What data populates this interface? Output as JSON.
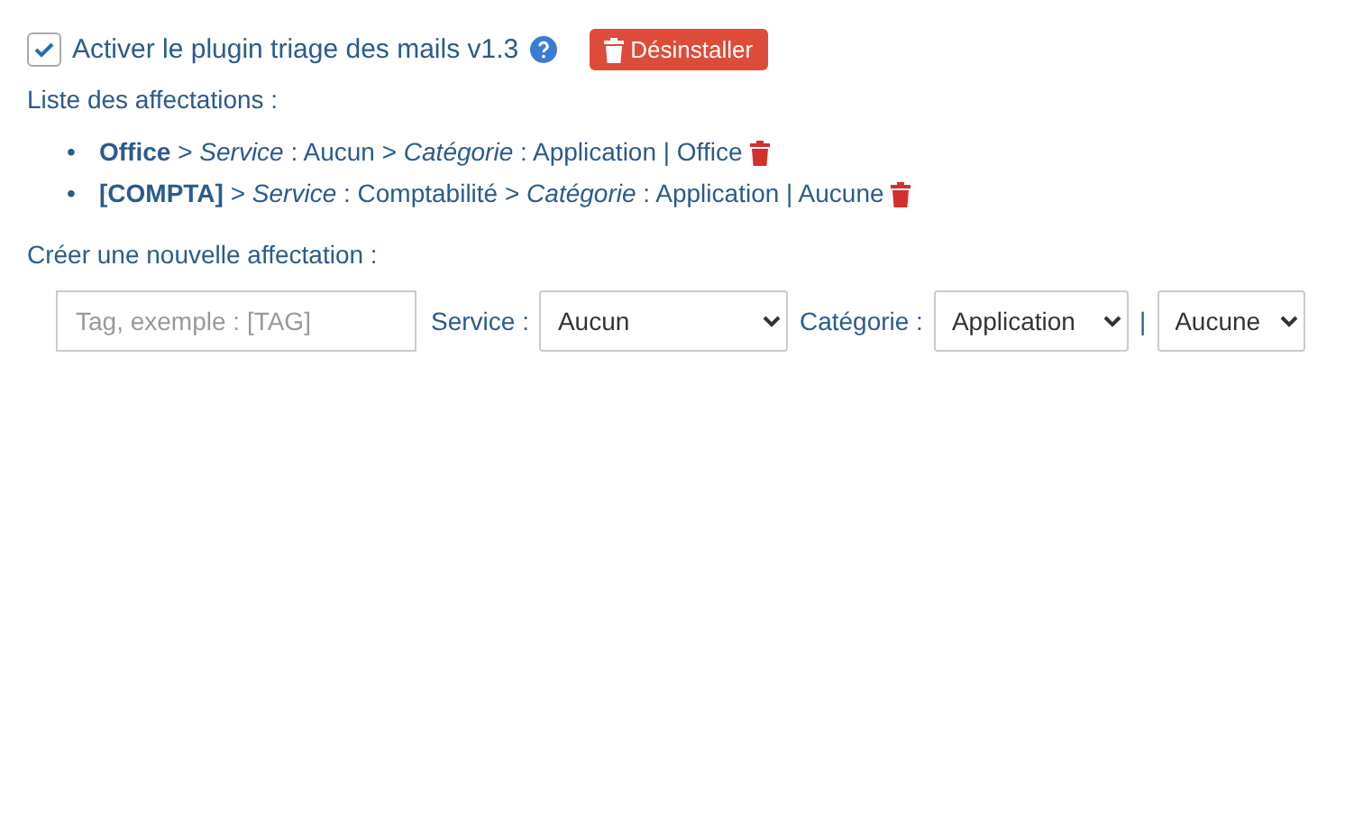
{
  "plugin": {
    "label": "Activer le plugin triage des mails v1.3",
    "checked": true,
    "uninstall": "Désinstaller"
  },
  "list_title": "Liste des affectations :",
  "assignments": [
    {
      "bullet": "•",
      "text": "**Office** > *Service* : Aucun > *Catégorie* : Application | Office"
    },
    {
      "bullet": "•",
      "text": "**[COMPTA]** > *Service* : Comptabilité > *Catégorie* : Application | Aucune"
    }
  ],
  "create_title": "Créer une nouvelle affectation :",
  "form": {
    "tag_placeholder": "Tag, exemple : [TAG]",
    "service_label": "Service :",
    "service": "Aucun",
    "category_label": "Catégorie :",
    "category": "Application",
    "separator": "|",
    "subcategory": "Aucune"
  }
}
